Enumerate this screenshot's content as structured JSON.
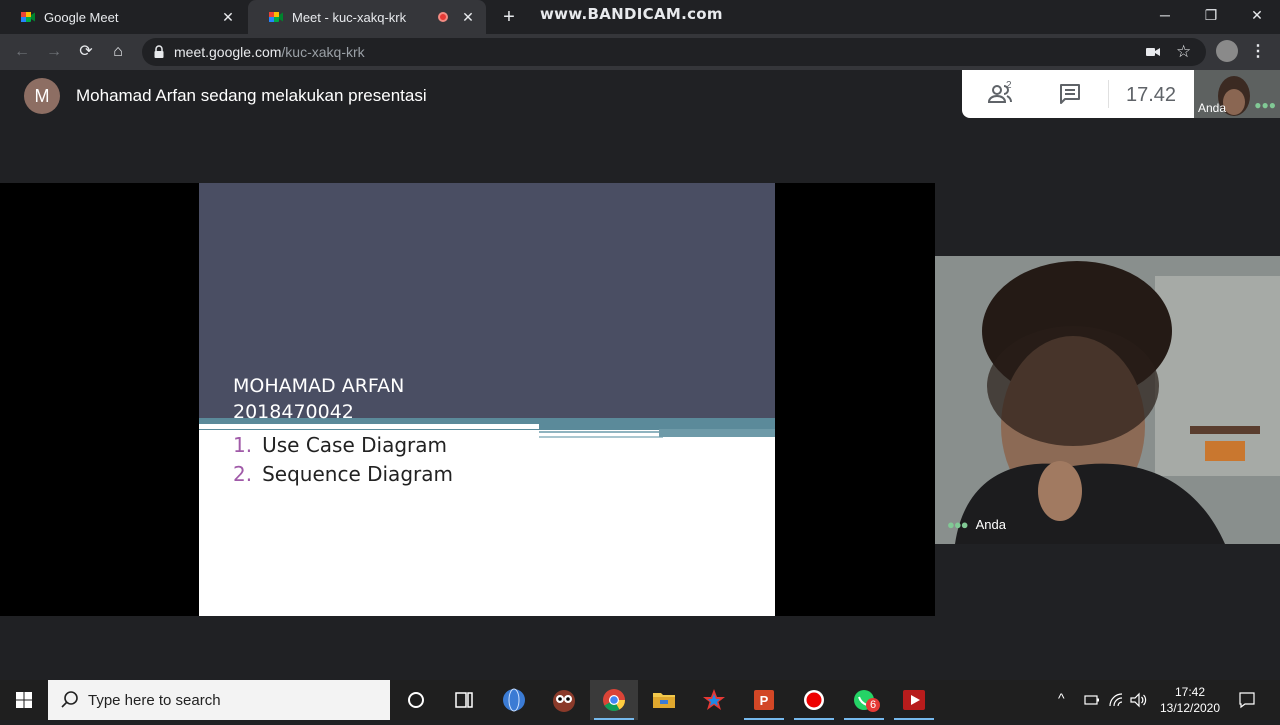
{
  "browser": {
    "tabs": [
      {
        "title": "Google Meet",
        "active": false
      },
      {
        "title": "Meet - kuc-xakq-krk",
        "active": true,
        "recording": true
      }
    ],
    "watermark": "www.BANDICAM.com",
    "url_host": "meet.google.com",
    "url_path": "/kuc-xakq-krk"
  },
  "meet": {
    "presenter_initial": "M",
    "presenter_text": "Mohamad Arfan sedang melakukan presentasi",
    "participant_count": "2",
    "clock": "17.42",
    "self_label": "Anda",
    "camera_label": "Anda"
  },
  "slide": {
    "name": "MOHAMAD ARFAN",
    "id_number": "2018470042",
    "items": [
      {
        "num": "1.",
        "text": "Use Case Diagram"
      },
      {
        "num": "2.",
        "text": "Sequence Diagram"
      }
    ]
  },
  "taskbar": {
    "search_placeholder": "Type here to search",
    "badge_count": "6",
    "time": "17:42",
    "date": "13/12/2020"
  },
  "colors": {
    "chrome_dark": "#202124",
    "toolbar": "#35363a",
    "slide_header": "#4a4e63",
    "slide_band": "#5b8a9a",
    "list_number": "#a05aa8",
    "accent_green": "#81c995"
  }
}
